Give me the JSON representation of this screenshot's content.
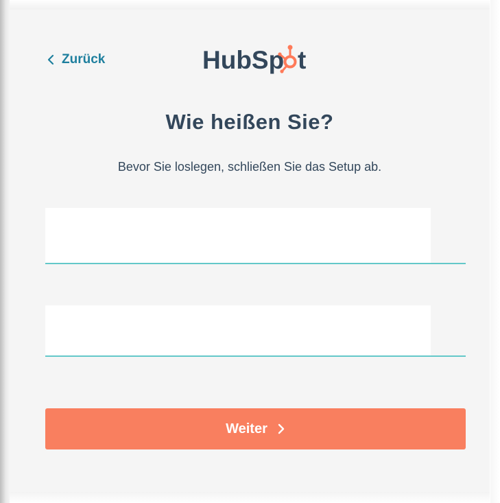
{
  "header": {
    "back_label": "Zurück",
    "logo_text_left": "HubSp",
    "logo_text_right": "t"
  },
  "main": {
    "title": "Wie heißen Sie?",
    "subtitle": "Bevor Sie loslegen, schließen Sie das Setup ab.",
    "first_name_value": "",
    "last_name_value": "",
    "continue_label": "Weiter"
  },
  "colors": {
    "accent_teal": "#1e7f9e",
    "heading": "#33475b",
    "button": "#f97f5f",
    "underline": "#63c8c9",
    "logo_orange": "#ff7a59"
  },
  "icons": {
    "back": "chevron-left-icon",
    "continue": "chevron-right-icon",
    "logo_sprocket": "sprocket-icon"
  }
}
